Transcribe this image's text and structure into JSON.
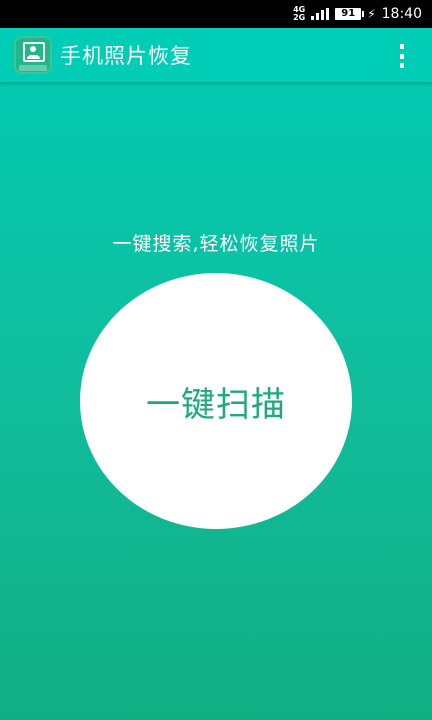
{
  "status_bar": {
    "network_top": "4G",
    "network_bottom": "2G",
    "battery": "91",
    "charging_icon": "bolt-icon",
    "time": "18:40"
  },
  "app_bar": {
    "icon": "photo-recovery-app-icon",
    "title": "手机照片恢复",
    "menu_icon": "overflow-menu-icon"
  },
  "main": {
    "slogan": "一键搜索,轻松恢复照片",
    "scan_button_label": "一键扫描"
  },
  "colors": {
    "primary": "#00CDB6",
    "gradient_bottom": "#12AF83",
    "button_text": "#1BAA7E"
  }
}
